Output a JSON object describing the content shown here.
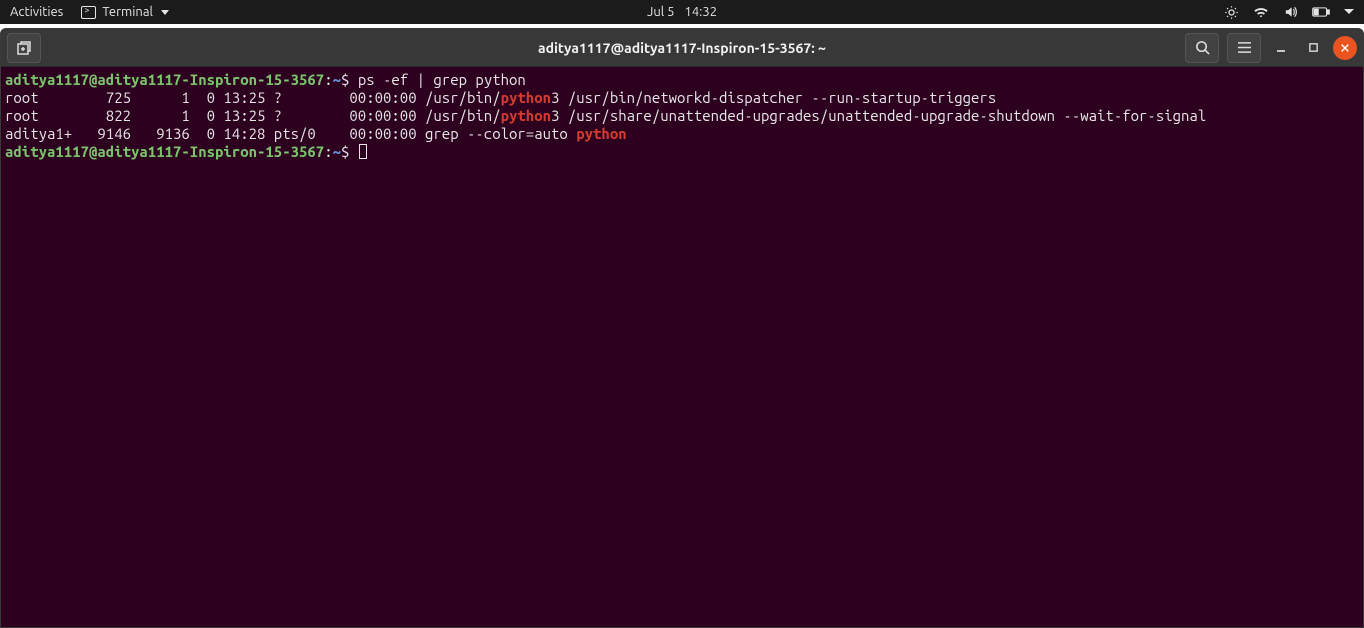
{
  "topbar": {
    "activities": "Activities",
    "app_name": "Terminal",
    "date": "Jul 5",
    "time": "14:32"
  },
  "window": {
    "title": "aditya1117@aditya1117-Inspiron-15-3567: ~"
  },
  "terminal": {
    "prompt_user_host": "aditya1117@aditya1117-Inspiron-15-3567",
    "prompt_path": "~",
    "prompt_sep1": ":",
    "prompt_sep2": "$",
    "command": "ps -ef | grep python",
    "match": "python",
    "rows": [
      {
        "user": "root    ",
        "pid": "  725",
        "ppid": "     1",
        "c": "0",
        "stime": "13:25",
        "tty": "?       ",
        "time": "00:00:00",
        "cmd_pre": "/usr/bin/",
        "cmd_post": "3 /usr/bin/networkd-dispatcher --run-startup-triggers"
      },
      {
        "user": "root    ",
        "pid": "  822",
        "ppid": "     1",
        "c": "0",
        "stime": "13:25",
        "tty": "?       ",
        "time": "00:00:00",
        "cmd_pre": "/usr/bin/",
        "cmd_post": "3 /usr/share/unattended-upgrades/unattended-upgrade-shutdown --wait-for-signal"
      },
      {
        "user": "aditya1+",
        "pid": " 9146",
        "ppid": "  9136",
        "c": "0",
        "stime": "14:28",
        "tty": "pts/0   ",
        "time": "00:00:00",
        "cmd_pre": "grep --color=auto ",
        "cmd_post": ""
      }
    ]
  }
}
